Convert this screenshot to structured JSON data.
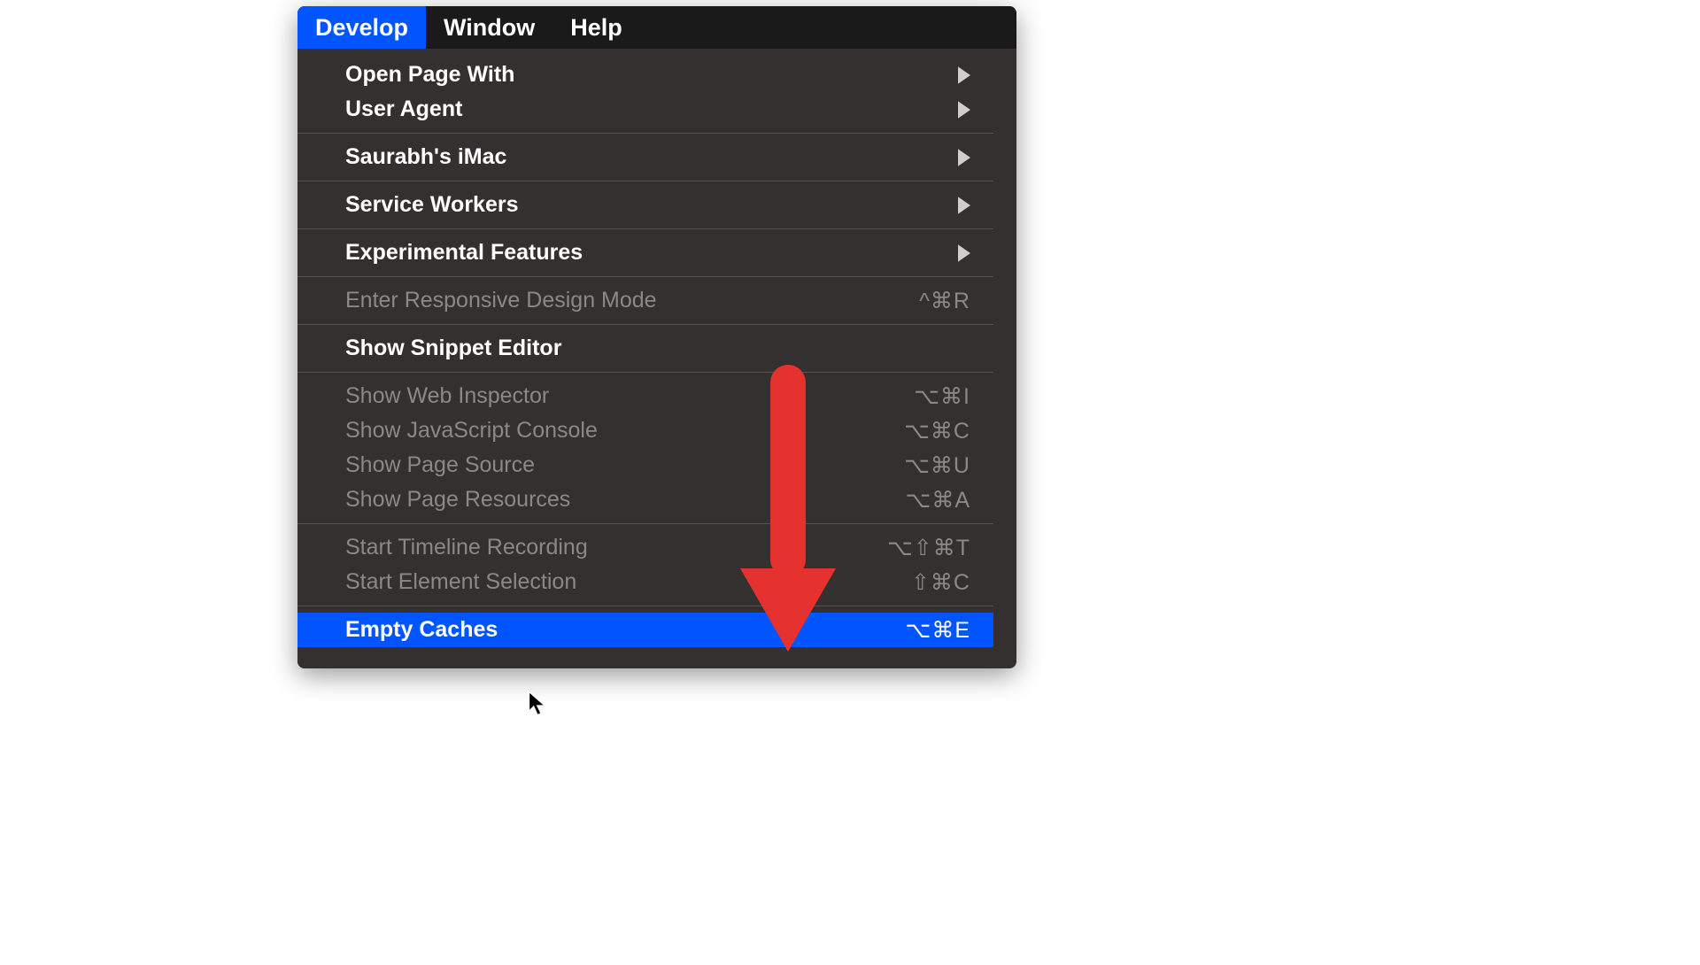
{
  "menubar": {
    "items": [
      {
        "label": "Develop",
        "selected": true
      },
      {
        "label": "Window",
        "selected": false
      },
      {
        "label": "Help",
        "selected": false
      }
    ]
  },
  "dropdown": {
    "groups": [
      [
        {
          "label": "Open Page With",
          "submenu": true,
          "disabled": false
        },
        {
          "label": "User Agent",
          "submenu": true,
          "disabled": false
        }
      ],
      [
        {
          "label": "Saurabh's iMac",
          "submenu": true,
          "disabled": false
        }
      ],
      [
        {
          "label": "Service Workers",
          "submenu": true,
          "disabled": false
        }
      ],
      [
        {
          "label": "Experimental Features",
          "submenu": true,
          "disabled": false
        }
      ],
      [
        {
          "label": "Enter Responsive Design Mode",
          "shortcut": "^⌘R",
          "disabled": true
        }
      ],
      [
        {
          "label": "Show Snippet Editor",
          "disabled": false
        }
      ],
      [
        {
          "label": "Show Web Inspector",
          "shortcut": "⌥⌘I",
          "disabled": true
        },
        {
          "label": "Show JavaScript Console",
          "shortcut": "⌥⌘C",
          "disabled": true
        },
        {
          "label": "Show Page Source",
          "shortcut": "⌥⌘U",
          "disabled": true
        },
        {
          "label": "Show Page Resources",
          "shortcut": "⌥⌘A",
          "disabled": true
        }
      ],
      [
        {
          "label": "Start Timeline Recording",
          "shortcut": "⌥⇧⌘T",
          "disabled": true
        },
        {
          "label": "Start Element Selection",
          "shortcut": "⇧⌘C",
          "disabled": true
        }
      ],
      [
        {
          "label": "Empty Caches",
          "shortcut": "⌥⌘E",
          "disabled": false,
          "hover": true
        }
      ]
    ]
  },
  "annotation": {
    "arrow_color": "#e6322e"
  }
}
